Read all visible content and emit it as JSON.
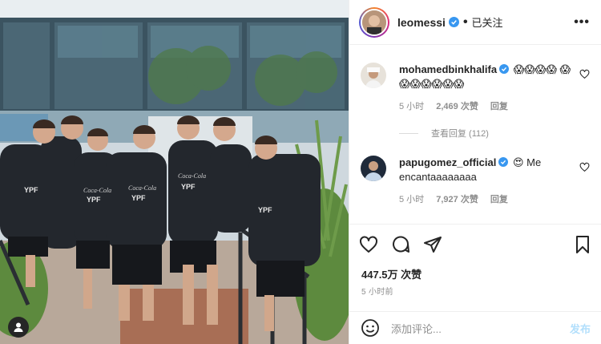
{
  "photo": {
    "shirt_sponsor": "YPF",
    "chest_sponsor": "Coca-Cola",
    "people_count": 7
  },
  "header": {
    "username": "leomessi",
    "separator": "•",
    "follow_state": "已关注",
    "more_label": "•••"
  },
  "comments": [
    {
      "username": "mohamedbinkhalifa",
      "text": "😱😱😱😱 😱😱😱😱😱😱😱",
      "time": "5 小时",
      "likes": "2,469 次赞",
      "reply": "回复"
    },
    {
      "username": "papugomez_official",
      "text": "😍 Me encantaaaaaaaa",
      "time": "5 小时",
      "likes": "7,927 次赞",
      "reply": "回复"
    }
  ],
  "view_replies": "查看回复 (112)",
  "post": {
    "likes": "447.5万 次赞",
    "time_ago": "5 小时前"
  },
  "composer": {
    "placeholder": "添加评论...",
    "post_label": "发布"
  },
  "colors": {
    "verified": "#3897f0",
    "post_button_disabled": "#b2dffc",
    "meta_text": "#8e8e8e"
  }
}
